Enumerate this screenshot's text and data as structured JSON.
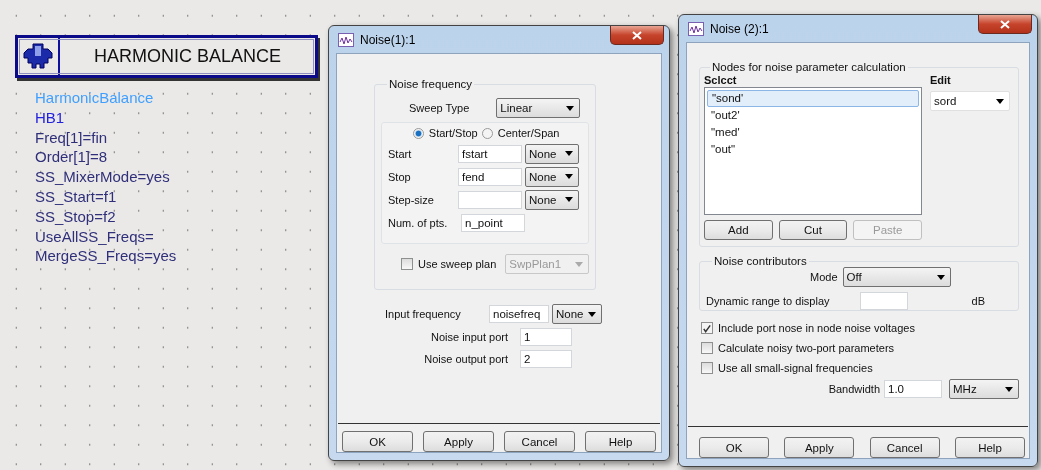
{
  "schematic": {
    "block_title": "HARMONIC BALANCE",
    "params": [
      {
        "text": "HarmonicBalance",
        "kind": "component"
      },
      {
        "text": "HB1",
        "kind": "instance"
      },
      {
        "text": "Freq[1]=fin",
        "kind": "param"
      },
      {
        "text": "Order[1]=8",
        "kind": "param"
      },
      {
        "text": "SS_MixerMode=yes",
        "kind": "param"
      },
      {
        "text": "SS_Start=f1",
        "kind": "param"
      },
      {
        "text": "SS_Stop=f2",
        "kind": "param"
      },
      {
        "text": "UseAllSS_Freqs=",
        "kind": "param"
      },
      {
        "text": "MergeSS_Freqs=yes",
        "kind": "param"
      }
    ]
  },
  "noise1": {
    "title": "Noise(1):1",
    "group_title": "Noise frequency",
    "sweep_type": {
      "label": "Sweep Type",
      "value": "Linear"
    },
    "modes": [
      {
        "label": "Start/Stop",
        "selected": true
      },
      {
        "label": "Center/Span",
        "selected": false
      }
    ],
    "rows": [
      {
        "label": "Start",
        "value": "fstart",
        "unit": "None"
      },
      {
        "label": "Stop",
        "value": "fend",
        "unit": "None"
      },
      {
        "label": "Step-size",
        "unit": "None"
      },
      {
        "label": "Num. of pts.",
        "value": "n_point"
      }
    ],
    "sweep_plan": {
      "label": "Use sweep plan",
      "checked": false,
      "value": "SwpPlan1",
      "disabled": true
    },
    "input_frequency": {
      "label": "Input frequency",
      "value": "noisefreq",
      "unit": "None"
    },
    "ports": [
      {
        "label": "Noise input port",
        "value": "1"
      },
      {
        "label": "Noise output port",
        "value": "2"
      }
    ],
    "buttons": [
      {
        "label": "OK",
        "disabled": false
      },
      {
        "label": "Apply",
        "disabled": false
      },
      {
        "label": "Cancel",
        "disabled": false
      },
      {
        "label": "Help",
        "disabled": false
      }
    ]
  },
  "noise2": {
    "title": "Noise (2):1",
    "group_title": "Nodes for noise parameter calculation",
    "select_label": "Sclcct",
    "edit_label": "Edit",
    "nodes": [
      {
        "label": "\"sond'",
        "selected": true
      },
      {
        "label": "\"out2'",
        "selected": false
      },
      {
        "label": "\"med'",
        "selected": false
      },
      {
        "label": "\"out\"",
        "selected": false
      }
    ],
    "edit_value": "sord",
    "list_buttons": [
      {
        "label": "Add",
        "disabled": false
      },
      {
        "label": "Cut",
        "disabled": false
      },
      {
        "label": "Paste",
        "disabled": true
      }
    ],
    "contributors": {
      "title": "Noise contributors",
      "mode_label": "Mode",
      "mode_value": "Off",
      "range_label": "Dynamic range to display",
      "range_unit": "dB"
    },
    "options": [
      {
        "label": "Include port nose in node noise voltages",
        "checked": true
      },
      {
        "label": "Calculate noisy two-port parameters",
        "checked": false
      },
      {
        "label": "Use all small-signal frequencies",
        "checked": false
      }
    ],
    "bandwidth": {
      "label": "Bandwidth",
      "value": "1.0",
      "unit": "MHz"
    },
    "buttons": [
      {
        "label": "OK",
        "disabled": false
      },
      {
        "label": "Apply",
        "disabled": false
      },
      {
        "label": "Cancel",
        "disabled": false
      },
      {
        "label": "Help",
        "disabled": false
      }
    ]
  }
}
